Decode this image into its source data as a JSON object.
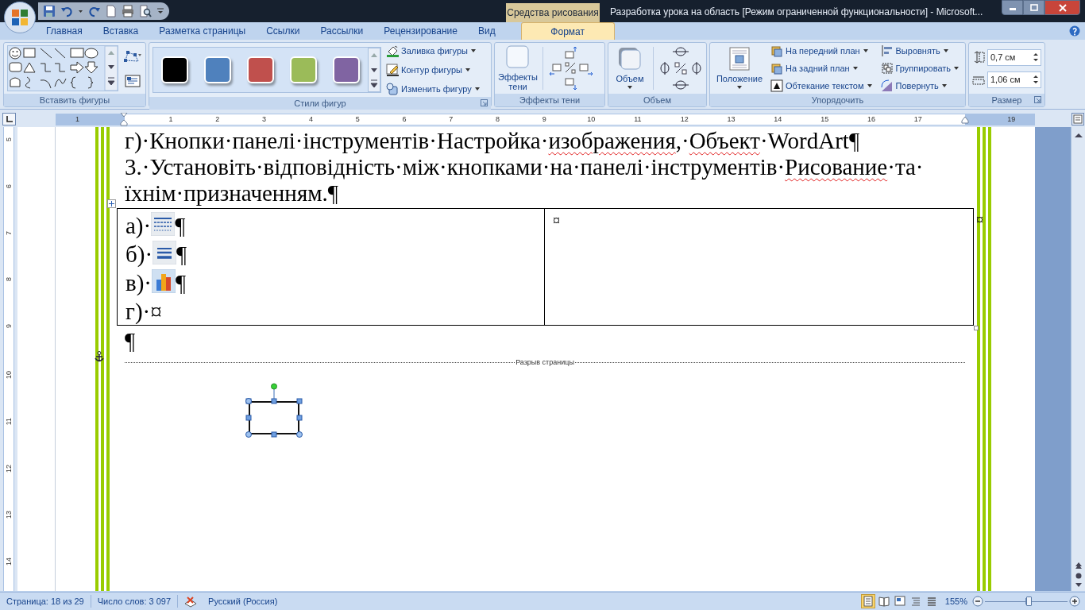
{
  "title_bar": {
    "contextual_tab": "Средства рисования",
    "title": "Разработка урока на область [Режим ограниченной функциональности] - Microsoft..."
  },
  "tabs": [
    {
      "label": "Главная",
      "selected": false
    },
    {
      "label": "Вставка",
      "selected": false
    },
    {
      "label": "Разметка страницы",
      "selected": false
    },
    {
      "label": "Ссылки",
      "selected": false
    },
    {
      "label": "Рассылки",
      "selected": false
    },
    {
      "label": "Рецензирование",
      "selected": false
    },
    {
      "label": "Вид",
      "selected": false
    },
    {
      "label": "Формат",
      "selected": true
    }
  ],
  "ribbon_groups": [
    {
      "kind": "shapes",
      "label": "Вставить фигуры"
    },
    {
      "kind": "styles",
      "label": "Стили фигур",
      "swatches": [
        {
          "color": "#000000"
        },
        {
          "color": "#4f81bd"
        },
        {
          "color": "#c0504d"
        },
        {
          "color": "#9bbb59"
        },
        {
          "color": "#8064a2"
        }
      ],
      "commands": [
        "Заливка фигуры",
        "Контур фигуры",
        "Изменить фигуру"
      ]
    },
    {
      "kind": "shadow",
      "label": "Эффекты тени",
      "button": [
        "Эффекты",
        "тени"
      ]
    },
    {
      "kind": "volume",
      "label": "Объем",
      "button": "Объем"
    },
    {
      "kind": "arrange",
      "label": "Упорядочить",
      "button": "Положение",
      "commands": [
        "На передний план",
        "На задний план",
        "Обтекание текстом",
        "Выровнять",
        "Группировать",
        "Повернуть"
      ]
    },
    {
      "kind": "size",
      "label": "Размер",
      "fields": [
        "0,7 см",
        "1,06 см"
      ]
    }
  ],
  "ruler": [
    {
      "kind": "number",
      "label": "1"
    },
    {
      "kind": "left-indent"
    },
    {
      "kind": "number",
      "label": "1"
    },
    {
      "kind": "number",
      "label": "2"
    },
    {
      "kind": "number",
      "label": "3"
    },
    {
      "kind": "number",
      "label": "4"
    },
    {
      "kind": "number",
      "label": "5"
    },
    {
      "kind": "number",
      "label": "6"
    },
    {
      "kind": "number",
      "label": "7"
    },
    {
      "kind": "number",
      "label": "8"
    },
    {
      "kind": "number",
      "label": "9"
    },
    {
      "kind": "number",
      "label": "10"
    },
    {
      "kind": "number",
      "label": "11"
    },
    {
      "kind": "number",
      "label": "12"
    },
    {
      "kind": "number",
      "label": "13"
    },
    {
      "kind": "number",
      "label": "14"
    },
    {
      "kind": "number",
      "label": "15"
    },
    {
      "kind": "number",
      "label": "16"
    },
    {
      "kind": "number",
      "label": "17"
    },
    {
      "kind": "right-indent"
    },
    {
      "kind": "number",
      "label": "19"
    }
  ],
  "vertical_ruler": [
    "5",
    "6",
    "7",
    "8",
    "9",
    "10",
    "11",
    "12",
    "13",
    "14"
  ],
  "document": {
    "paragraphs": [
      {
        "runs": [
          {
            "text": "г)·Кнопки·панелі·інструментів·Настройка·",
            "misspelled": false
          },
          {
            "text": "изображения",
            "misspelled": true
          },
          {
            "text": ",·",
            "misspelled": false
          },
          {
            "text": "Объект",
            "misspelled": true
          },
          {
            "text": "·WordArt¶",
            "misspelled": false
          }
        ]
      },
      {
        "runs": [
          {
            "text": "3.·Установіть·відповідність·між·кнопками·на·панелі·інструментів·",
            "misspelled": false
          },
          {
            "text": "Рисование",
            "misspelled": true
          },
          {
            "text": "·та·їхнім·призначенням.¶",
            "misspelled": false
          }
        ]
      }
    ],
    "table": {
      "left_cell": [
        {
          "kind": "dashes",
          "label": "а)·",
          "end": "¶"
        },
        {
          "kind": "lines",
          "label": "б)·",
          "end": "¶"
        },
        {
          "kind": "chart",
          "label": "в)·",
          "end": "¶"
        },
        {
          "kind": "text",
          "label": "г)·",
          "end": "¤"
        }
      ],
      "right_cell": "¤",
      "row_end": "¤"
    },
    "after_table": "¶",
    "page_break": "Разрыв страницы",
    "shape": {
      "selected": true
    }
  },
  "status_bar": {
    "page": "Страница: 18 из 29",
    "words": "Число слов: 3 097",
    "language": "Русский (Россия)",
    "views": [
      {
        "selected": true
      },
      {
        "selected": false
      },
      {
        "selected": false
      },
      {
        "selected": false
      },
      {
        "selected": false
      }
    ],
    "zoom": "155%",
    "zoom_slider": {
      "level": 0.54
    }
  }
}
